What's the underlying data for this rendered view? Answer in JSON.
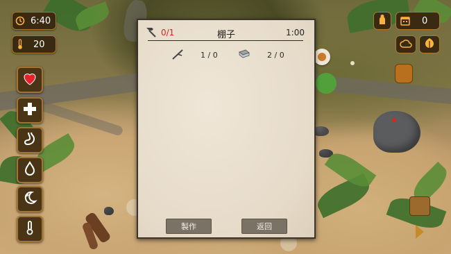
{
  "hud": {
    "time": "6:40",
    "temperature": "20",
    "inventory_count": "0",
    "colors": {
      "pill_bg": "#3b2a12",
      "pill_border": "#a57a3a",
      "icon_orange": "#ffb13b",
      "heart_red": "#e5232c"
    }
  },
  "side_buttons": [
    {
      "name": "health-heart-icon",
      "icon": "heart"
    },
    {
      "name": "first-aid-icon",
      "icon": "plus"
    },
    {
      "name": "stomach-icon",
      "icon": "stomach"
    },
    {
      "name": "water-drop-icon",
      "icon": "drop"
    },
    {
      "name": "sleep-moon-icon",
      "icon": "moon"
    },
    {
      "name": "thermometer-icon",
      "icon": "thermometer"
    }
  ],
  "craft_panel": {
    "progress": "0/1",
    "title": "棚子",
    "time": "1:00",
    "requirements": [
      {
        "icon": "stick-icon",
        "count": "1 / 0"
      },
      {
        "icon": "cloth-icon",
        "count": "2 / 0"
      }
    ],
    "craft_label": "製作",
    "back_label": "返回",
    "colors": {
      "progress_red": "#d42a1e",
      "paper": "#e9dfcf",
      "button": "#7a7264"
    }
  }
}
